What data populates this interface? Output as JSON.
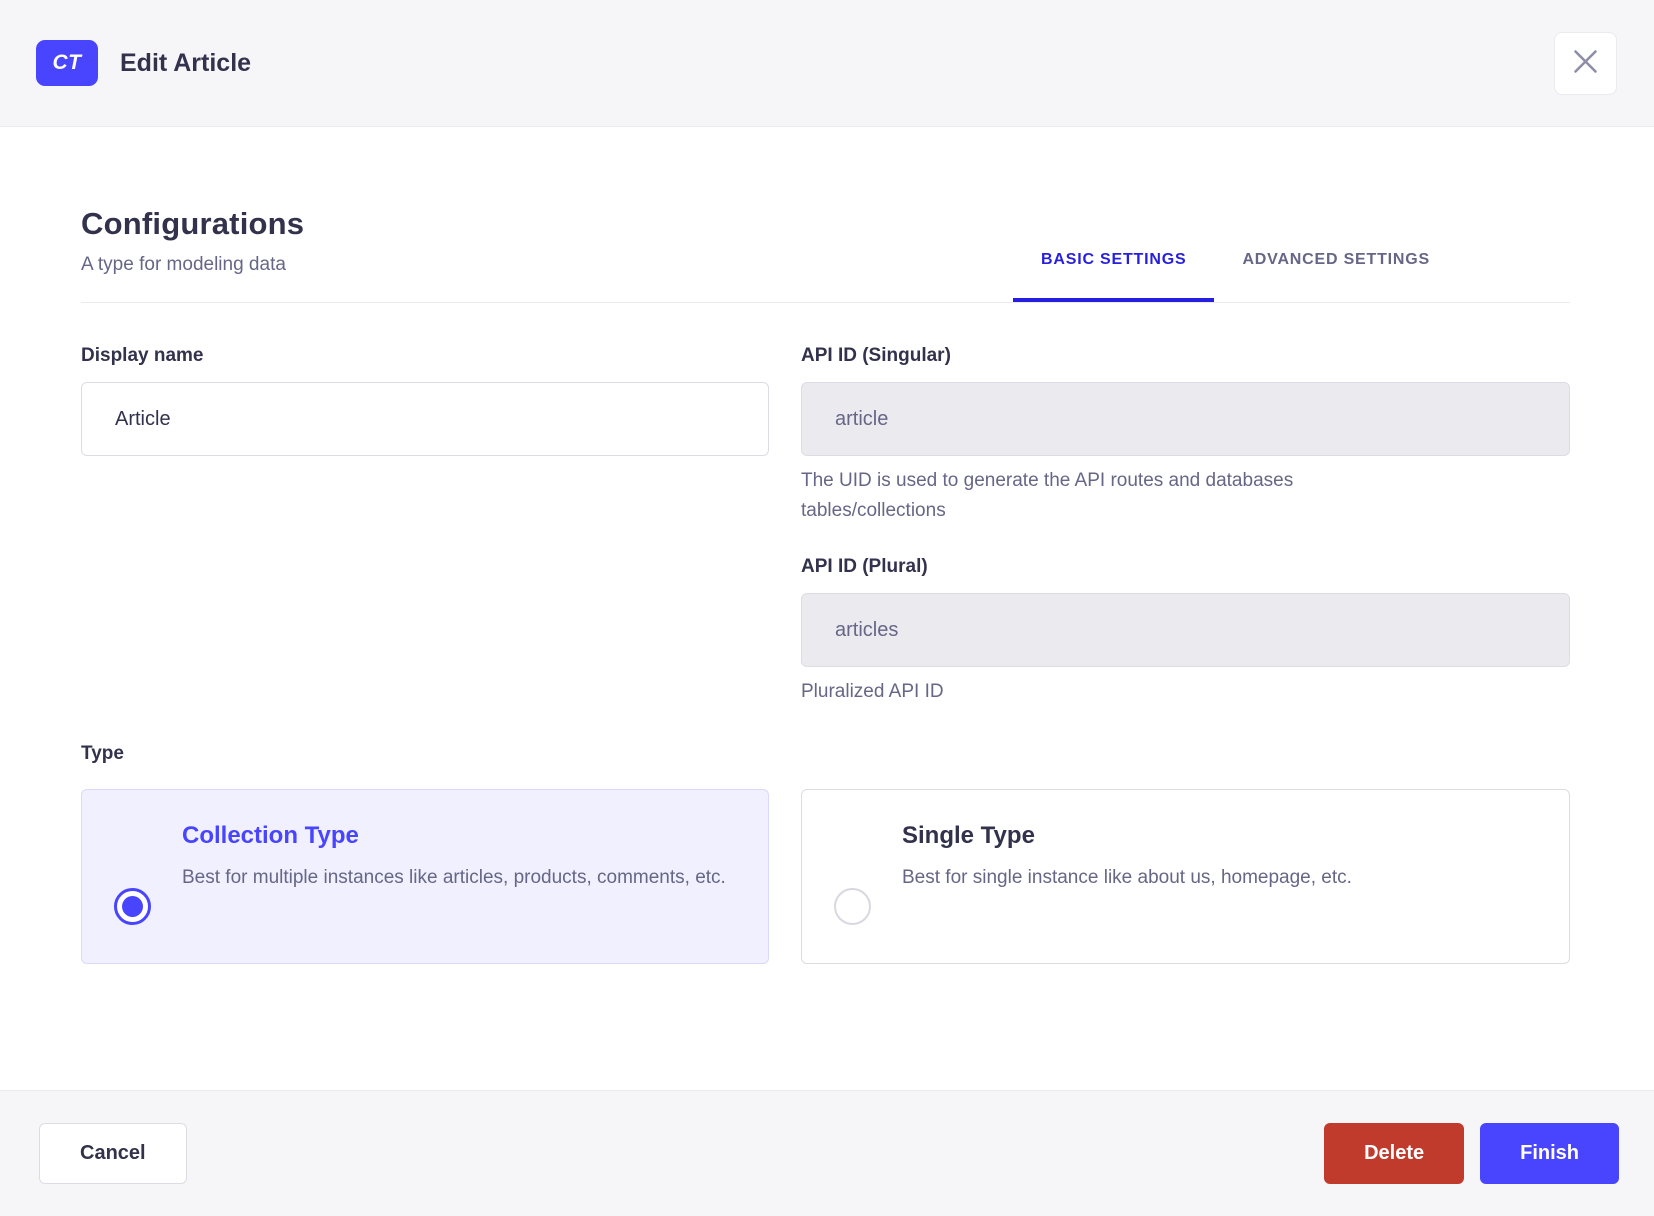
{
  "header": {
    "badge": "CT",
    "title": "Edit Article",
    "close_icon": "x-mark"
  },
  "section": {
    "title": "Configurations",
    "subtitle": "A type for modeling data"
  },
  "tabs": [
    {
      "label": "BASIC SETTINGS",
      "active": true
    },
    {
      "label": "ADVANCED SETTINGS",
      "active": false
    }
  ],
  "form": {
    "display_name": {
      "label": "Display name",
      "value": "Article"
    },
    "api_id_singular": {
      "label": "API ID (Singular)",
      "value": "article",
      "help": "The UID is used to generate the API routes and databases tables/collections"
    },
    "api_id_plural": {
      "label": "API ID (Plural)",
      "value": "articles",
      "help": "Pluralized API ID"
    },
    "type": {
      "label": "Type",
      "options": [
        {
          "title": "Collection Type",
          "description": "Best for multiple instances like articles, products, comments, etc.",
          "selected": true
        },
        {
          "title": "Single Type",
          "description": "Best for single instance like about us, homepage, etc.",
          "selected": false
        }
      ]
    }
  },
  "footer": {
    "cancel": "Cancel",
    "delete": "Delete",
    "finish": "Finish"
  },
  "colors": {
    "accent": "#4945ff",
    "active_tab": "#271fe0",
    "danger": "#c13b2c",
    "text": "#32324d",
    "muted_text": "#666687",
    "border": "#dcdce4",
    "surface": "#f6f6f9",
    "selected_card_bg": "#f0f0ff"
  }
}
